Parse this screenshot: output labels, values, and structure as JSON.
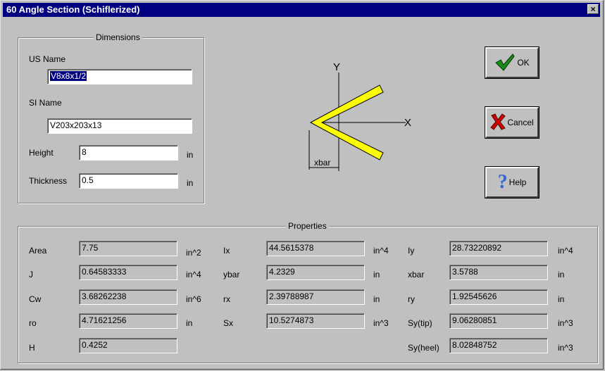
{
  "window": {
    "title": "60 Angle Section (Schiflerized)"
  },
  "icons": {
    "close": "close-icon",
    "ok": "check-icon",
    "cancel": "x-icon",
    "help": "question-icon"
  },
  "dimensions": {
    "legend": "Dimensions",
    "us_name_label": "US Name",
    "us_name_value": "V8x8x1/2",
    "si_name_label": "SI Name",
    "si_name_value": "V203x203x13",
    "height_label": "Height",
    "height_value": "8",
    "height_unit": "in",
    "thickness_label": "Thickness",
    "thickness_value": "0.5",
    "thickness_unit": "in"
  },
  "diagram": {
    "y_axis": "Y",
    "x_axis": "X",
    "xbar": "xbar",
    "shape_color": "#ffff00"
  },
  "buttons": {
    "ok": "OK",
    "cancel": "Cancel",
    "help": "Help"
  },
  "properties": {
    "legend": "Properties",
    "area_label": "Area",
    "area_value": "7.75",
    "area_unit": "in^2",
    "j_label": "J",
    "j_value": "0.64583333",
    "j_unit": "in^4",
    "cw_label": "Cw",
    "cw_value": "3.68262238",
    "cw_unit": "in^6",
    "ro_label": "ro",
    "ro_value": "4.71621256",
    "ro_unit": "in",
    "h_label": "H",
    "h_value": "0.4252",
    "ix_label": "Ix",
    "ix_value": "44.5615378",
    "ix_unit": "in^4",
    "ybar_label": "ybar",
    "ybar_value": "4.2329",
    "ybar_unit": "in",
    "rx_label": "rx",
    "rx_value": "2.39788987",
    "rx_unit": "in",
    "sx_label": "Sx",
    "sx_value": "10.5274873",
    "sx_unit": "in^3",
    "iy_label": "Iy",
    "iy_value": "28.73220892",
    "iy_unit": "in^4",
    "xbar_label": "xbar",
    "xbar_value": "3.5788",
    "xbar_unit": "in",
    "ry_label": "ry",
    "ry_value": "1.92545626",
    "ry_unit": "in",
    "sytip_label": "Sy(tip)",
    "sytip_value": "9.06280851",
    "sytip_unit": "in^3",
    "syheel_label": "Sy(heel)",
    "syheel_value": "8.02848752",
    "syheel_unit": "in^3"
  }
}
